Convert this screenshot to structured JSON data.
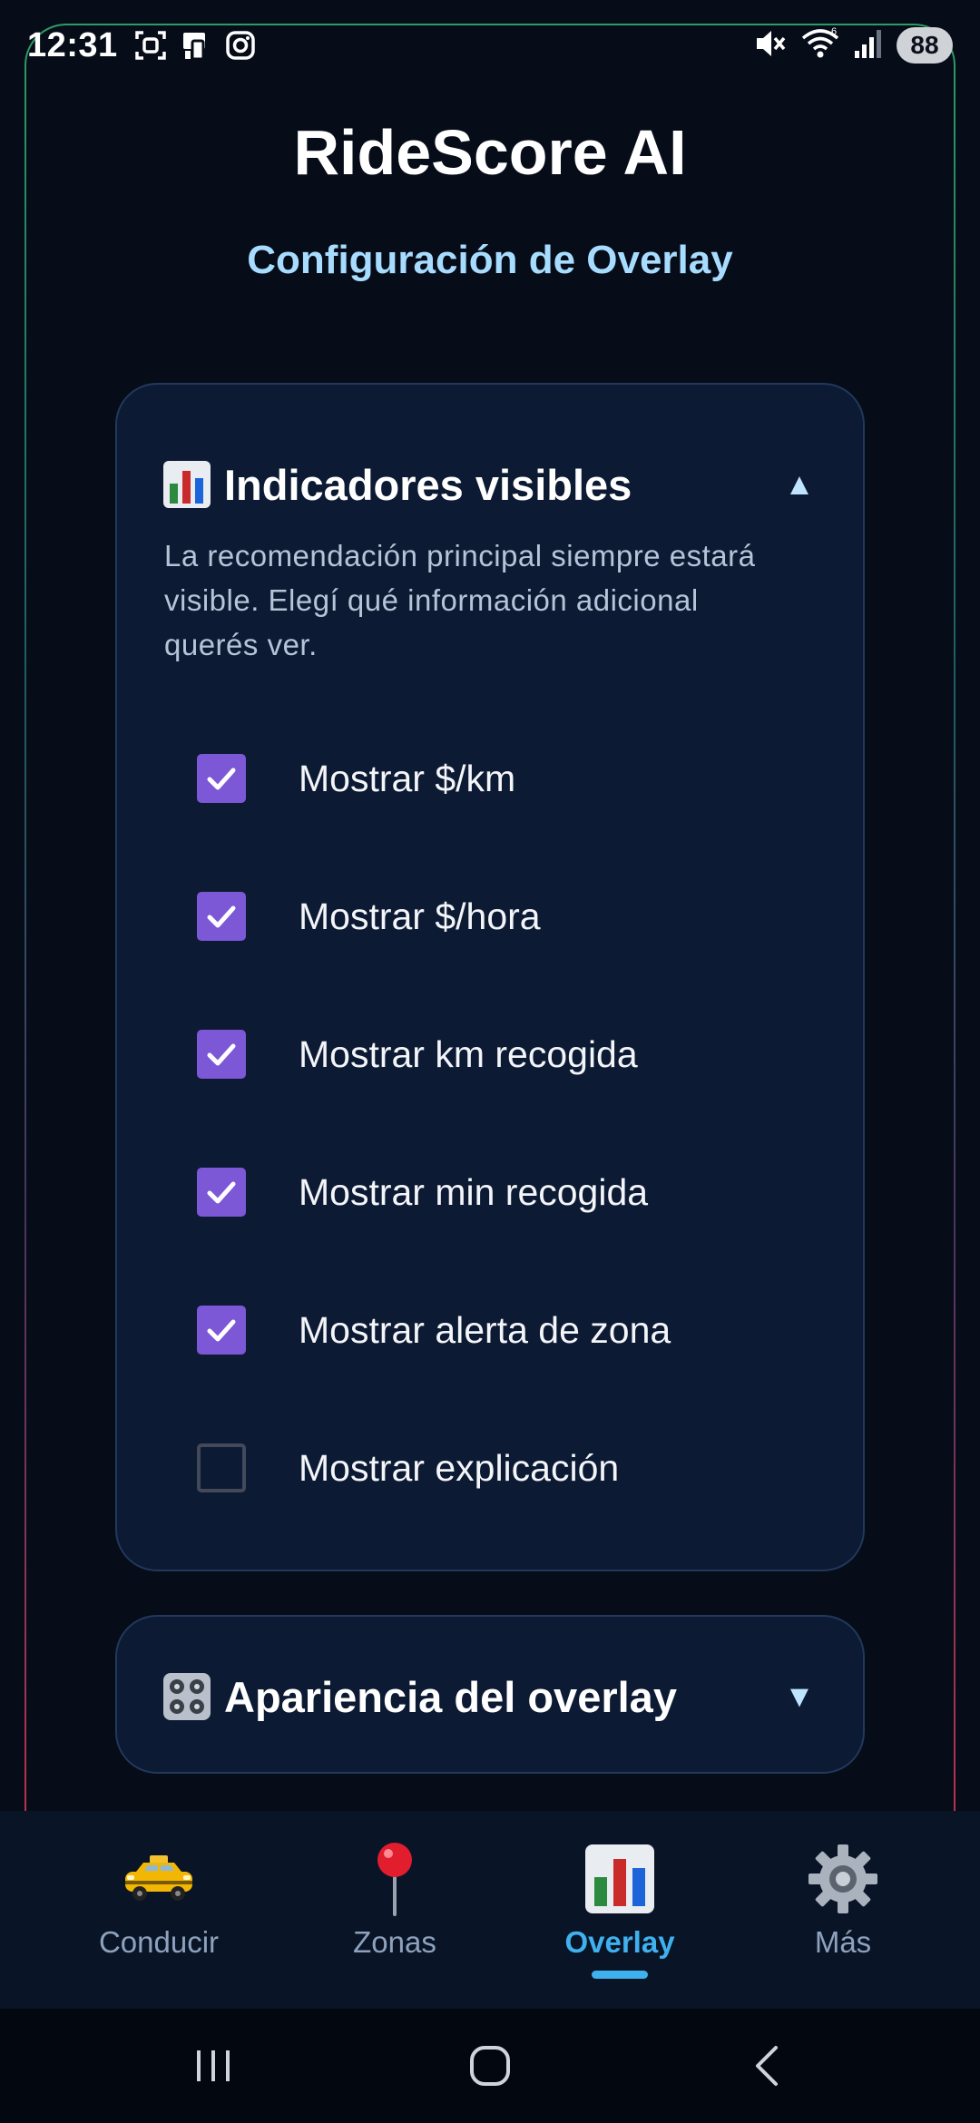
{
  "status_bar": {
    "time": "12:31",
    "battery": "88",
    "left_icons": [
      "screenshot-icon",
      "phone-device-icon",
      "instagram-icon"
    ],
    "right_icons": [
      "mute-icon",
      "wifi-icon",
      "signal-icon"
    ]
  },
  "header": {
    "title": "RideScore AI",
    "subtitle": "Configuración de Overlay"
  },
  "indicators_card": {
    "icon": "bar-chart-icon",
    "title": "Indicadores visibles",
    "chevron": "▲",
    "expanded": true,
    "description": "La recomendación principal siempre estará visible. Elegí qué información adicional querés ver.",
    "options": [
      {
        "label": "Mostrar $/km",
        "checked": true
      },
      {
        "label": "Mostrar $/hora",
        "checked": true
      },
      {
        "label": "Mostrar km recogida",
        "checked": true
      },
      {
        "label": "Mostrar min recogida",
        "checked": true
      },
      {
        "label": "Mostrar alerta de zona",
        "checked": true
      },
      {
        "label": "Mostrar explicación",
        "checked": false
      }
    ]
  },
  "appearance_card": {
    "icon": "control-knobs-icon",
    "title": "Apariencia del overlay",
    "chevron": "▼",
    "expanded": false
  },
  "bottom_nav": {
    "items": [
      {
        "label": "Conducir",
        "icon": "taxi-icon",
        "active": false
      },
      {
        "label": "Zonas",
        "icon": "pushpin-icon",
        "active": false
      },
      {
        "label": "Overlay",
        "icon": "bar-chart-icon",
        "active": true
      },
      {
        "label": "Más",
        "icon": "gear-icon",
        "active": false
      }
    ]
  },
  "colors": {
    "background": "#060c18",
    "card": "#0c1a33",
    "accent": "#3fb1ee",
    "subtitle": "#a7dcff",
    "checkbox": "#7c57d6"
  }
}
